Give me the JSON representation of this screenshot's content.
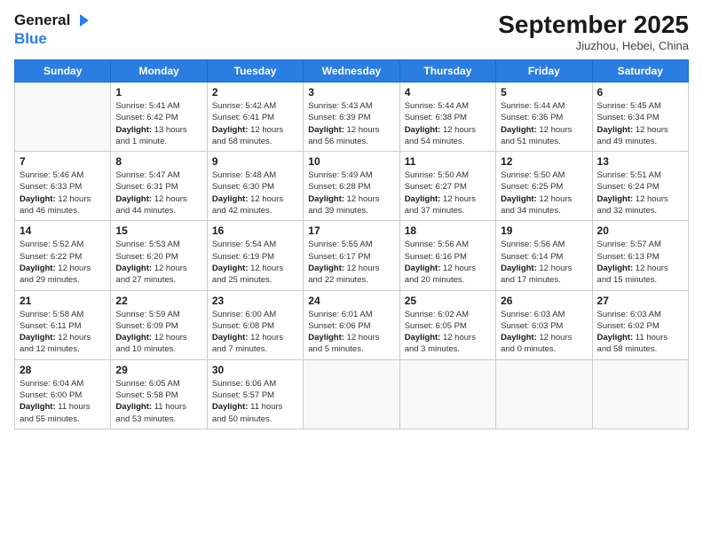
{
  "header": {
    "logo_line1": "General",
    "logo_line2": "Blue",
    "month": "September 2025",
    "location": "Jiuzhou, Hebei, China"
  },
  "weekdays": [
    "Sunday",
    "Monday",
    "Tuesday",
    "Wednesday",
    "Thursday",
    "Friday",
    "Saturday"
  ],
  "weeks": [
    [
      {
        "day": "",
        "sunrise": "",
        "sunset": "",
        "daylight": ""
      },
      {
        "day": "1",
        "sunrise": "Sunrise: 5:41 AM",
        "sunset": "Sunset: 6:42 PM",
        "daylight": "Daylight: 13 hours and 1 minute."
      },
      {
        "day": "2",
        "sunrise": "Sunrise: 5:42 AM",
        "sunset": "Sunset: 6:41 PM",
        "daylight": "Daylight: 12 hours and 58 minutes."
      },
      {
        "day": "3",
        "sunrise": "Sunrise: 5:43 AM",
        "sunset": "Sunset: 6:39 PM",
        "daylight": "Daylight: 12 hours and 56 minutes."
      },
      {
        "day": "4",
        "sunrise": "Sunrise: 5:44 AM",
        "sunset": "Sunset: 6:38 PM",
        "daylight": "Daylight: 12 hours and 54 minutes."
      },
      {
        "day": "5",
        "sunrise": "Sunrise: 5:44 AM",
        "sunset": "Sunset: 6:36 PM",
        "daylight": "Daylight: 12 hours and 51 minutes."
      },
      {
        "day": "6",
        "sunrise": "Sunrise: 5:45 AM",
        "sunset": "Sunset: 6:34 PM",
        "daylight": "Daylight: 12 hours and 49 minutes."
      }
    ],
    [
      {
        "day": "7",
        "sunrise": "Sunrise: 5:46 AM",
        "sunset": "Sunset: 6:33 PM",
        "daylight": "Daylight: 12 hours and 46 minutes."
      },
      {
        "day": "8",
        "sunrise": "Sunrise: 5:47 AM",
        "sunset": "Sunset: 6:31 PM",
        "daylight": "Daylight: 12 hours and 44 minutes."
      },
      {
        "day": "9",
        "sunrise": "Sunrise: 5:48 AM",
        "sunset": "Sunset: 6:30 PM",
        "daylight": "Daylight: 12 hours and 42 minutes."
      },
      {
        "day": "10",
        "sunrise": "Sunrise: 5:49 AM",
        "sunset": "Sunset: 6:28 PM",
        "daylight": "Daylight: 12 hours and 39 minutes."
      },
      {
        "day": "11",
        "sunrise": "Sunrise: 5:50 AM",
        "sunset": "Sunset: 6:27 PM",
        "daylight": "Daylight: 12 hours and 37 minutes."
      },
      {
        "day": "12",
        "sunrise": "Sunrise: 5:50 AM",
        "sunset": "Sunset: 6:25 PM",
        "daylight": "Daylight: 12 hours and 34 minutes."
      },
      {
        "day": "13",
        "sunrise": "Sunrise: 5:51 AM",
        "sunset": "Sunset: 6:24 PM",
        "daylight": "Daylight: 12 hours and 32 minutes."
      }
    ],
    [
      {
        "day": "14",
        "sunrise": "Sunrise: 5:52 AM",
        "sunset": "Sunset: 6:22 PM",
        "daylight": "Daylight: 12 hours and 29 minutes."
      },
      {
        "day": "15",
        "sunrise": "Sunrise: 5:53 AM",
        "sunset": "Sunset: 6:20 PM",
        "daylight": "Daylight: 12 hours and 27 minutes."
      },
      {
        "day": "16",
        "sunrise": "Sunrise: 5:54 AM",
        "sunset": "Sunset: 6:19 PM",
        "daylight": "Daylight: 12 hours and 25 minutes."
      },
      {
        "day": "17",
        "sunrise": "Sunrise: 5:55 AM",
        "sunset": "Sunset: 6:17 PM",
        "daylight": "Daylight: 12 hours and 22 minutes."
      },
      {
        "day": "18",
        "sunrise": "Sunrise: 5:56 AM",
        "sunset": "Sunset: 6:16 PM",
        "daylight": "Daylight: 12 hours and 20 minutes."
      },
      {
        "day": "19",
        "sunrise": "Sunrise: 5:56 AM",
        "sunset": "Sunset: 6:14 PM",
        "daylight": "Daylight: 12 hours and 17 minutes."
      },
      {
        "day": "20",
        "sunrise": "Sunrise: 5:57 AM",
        "sunset": "Sunset: 6:13 PM",
        "daylight": "Daylight: 12 hours and 15 minutes."
      }
    ],
    [
      {
        "day": "21",
        "sunrise": "Sunrise: 5:58 AM",
        "sunset": "Sunset: 6:11 PM",
        "daylight": "Daylight: 12 hours and 12 minutes."
      },
      {
        "day": "22",
        "sunrise": "Sunrise: 5:59 AM",
        "sunset": "Sunset: 6:09 PM",
        "daylight": "Daylight: 12 hours and 10 minutes."
      },
      {
        "day": "23",
        "sunrise": "Sunrise: 6:00 AM",
        "sunset": "Sunset: 6:08 PM",
        "daylight": "Daylight: 12 hours and 7 minutes."
      },
      {
        "day": "24",
        "sunrise": "Sunrise: 6:01 AM",
        "sunset": "Sunset: 6:06 PM",
        "daylight": "Daylight: 12 hours and 5 minutes."
      },
      {
        "day": "25",
        "sunrise": "Sunrise: 6:02 AM",
        "sunset": "Sunset: 6:05 PM",
        "daylight": "Daylight: 12 hours and 3 minutes."
      },
      {
        "day": "26",
        "sunrise": "Sunrise: 6:03 AM",
        "sunset": "Sunset: 6:03 PM",
        "daylight": "Daylight: 12 hours and 0 minutes."
      },
      {
        "day": "27",
        "sunrise": "Sunrise: 6:03 AM",
        "sunset": "Sunset: 6:02 PM",
        "daylight": "Daylight: 11 hours and 58 minutes."
      }
    ],
    [
      {
        "day": "28",
        "sunrise": "Sunrise: 6:04 AM",
        "sunset": "Sunset: 6:00 PM",
        "daylight": "Daylight: 11 hours and 55 minutes."
      },
      {
        "day": "29",
        "sunrise": "Sunrise: 6:05 AM",
        "sunset": "Sunset: 5:58 PM",
        "daylight": "Daylight: 11 hours and 53 minutes."
      },
      {
        "day": "30",
        "sunrise": "Sunrise: 6:06 AM",
        "sunset": "Sunset: 5:57 PM",
        "daylight": "Daylight: 11 hours and 50 minutes."
      },
      {
        "day": "",
        "sunrise": "",
        "sunset": "",
        "daylight": ""
      },
      {
        "day": "",
        "sunrise": "",
        "sunset": "",
        "daylight": ""
      },
      {
        "day": "",
        "sunrise": "",
        "sunset": "",
        "daylight": ""
      },
      {
        "day": "",
        "sunrise": "",
        "sunset": "",
        "daylight": ""
      }
    ]
  ]
}
